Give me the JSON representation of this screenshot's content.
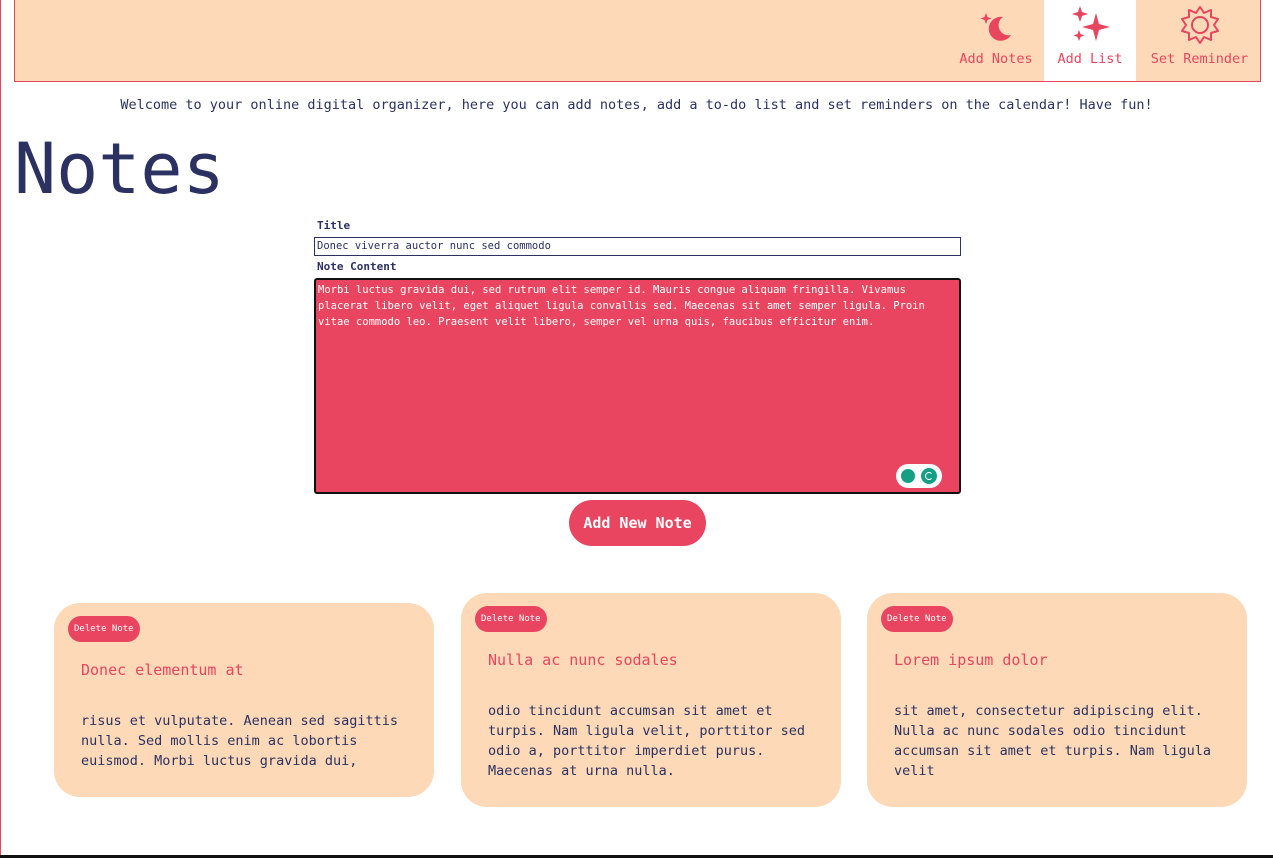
{
  "nav": {
    "items": [
      {
        "label": "Add Notes",
        "icon": "moon-stars-icon"
      },
      {
        "label": "Add List",
        "icon": "sparkles-icon"
      },
      {
        "label": "Set Reminder",
        "icon": "sun-icon"
      }
    ],
    "active": "Add List"
  },
  "welcome_text": "Welcome to your online digital organizer, here you can add notes, add a to-do list and set reminders on the calendar! Have fun!",
  "page_title": "Notes",
  "form": {
    "title_label": "Title",
    "title_value": "Donec viverra auctor nunc sed commodo",
    "content_label": "Note Content",
    "content_value": "Morbi luctus gravida dui, sed rutrum elit semper id. Mauris congue aliquam fringilla. Vivamus placerat libero velit, eget aliquet ligula convallis sed. Maecenas sit amet semper ligula. Proin vitae commodo leo. Praesent velit libero, semper vel urna quis, faucibus efficitur enim.",
    "add_button": "Add New Note"
  },
  "notes": [
    {
      "delete_label": "Delete Note",
      "title": "Donec elementum at",
      "body": "risus et vulputate. Aenean sed sagittis nulla. Sed mollis enim ac lobortis euismod. Morbi luctus gravida dui,"
    },
    {
      "delete_label": "Delete Note",
      "title": "Nulla ac nunc sodales",
      "body": "odio tincidunt accumsan sit amet et turpis. Nam ligula velit, porttitor sed odio a, porttitor imperdiet purus. Maecenas at urna nulla."
    },
    {
      "delete_label": "Delete Note",
      "title": "Lorem ipsum dolor",
      "body": "sit amet, consectetur adipiscing elit. Nulla ac nunc sodales odio tincidunt accumsan sit amet et turpis. Nam ligula velit"
    }
  ],
  "colors": {
    "accent": "#ea4560",
    "peach": "#fdd9b7",
    "navy": "#2b3160"
  }
}
